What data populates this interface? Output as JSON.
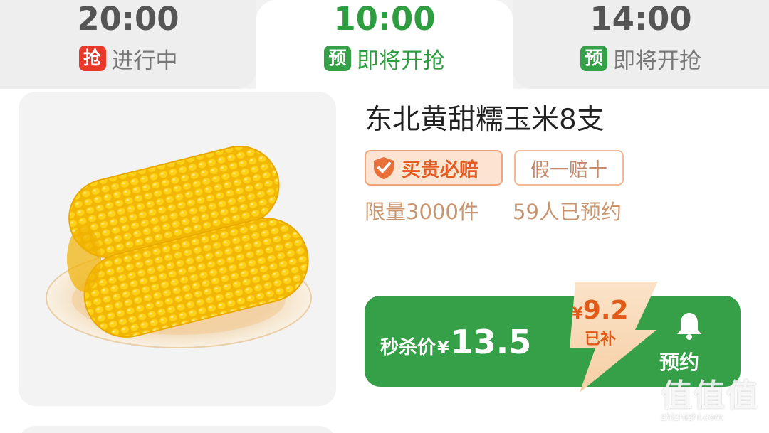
{
  "tabs": [
    {
      "time": "20:00",
      "badge": "抢",
      "badge_color": "#e8392b",
      "status": "进行中",
      "active": false
    },
    {
      "time": "10:00",
      "badge": "预",
      "badge_color": "#35a047",
      "status": "即将开抢",
      "active": true
    },
    {
      "time": "14:00",
      "badge": "预",
      "badge_color": "#35a047",
      "status": "即将开抢",
      "active": false
    }
  ],
  "product": {
    "title": "东北黄甜糯玉米8支",
    "tags": {
      "guarantee": "买贵必赔",
      "fake": "假一赔十"
    },
    "limit": "限量3000件",
    "reserved": "59人已预约",
    "price_label": "秒杀价",
    "currency": "¥",
    "price": "13.5",
    "subsidy_currency": "¥",
    "subsidy_amount": "9.2",
    "subsidy_label": "已补",
    "reserve_button": "预约"
  },
  "watermark": {
    "logo": "值",
    "url": "zhizhizhi.com"
  },
  "colors": {
    "accent_green": "#35a047",
    "red": "#e8392b",
    "orange": "#e25c24"
  }
}
